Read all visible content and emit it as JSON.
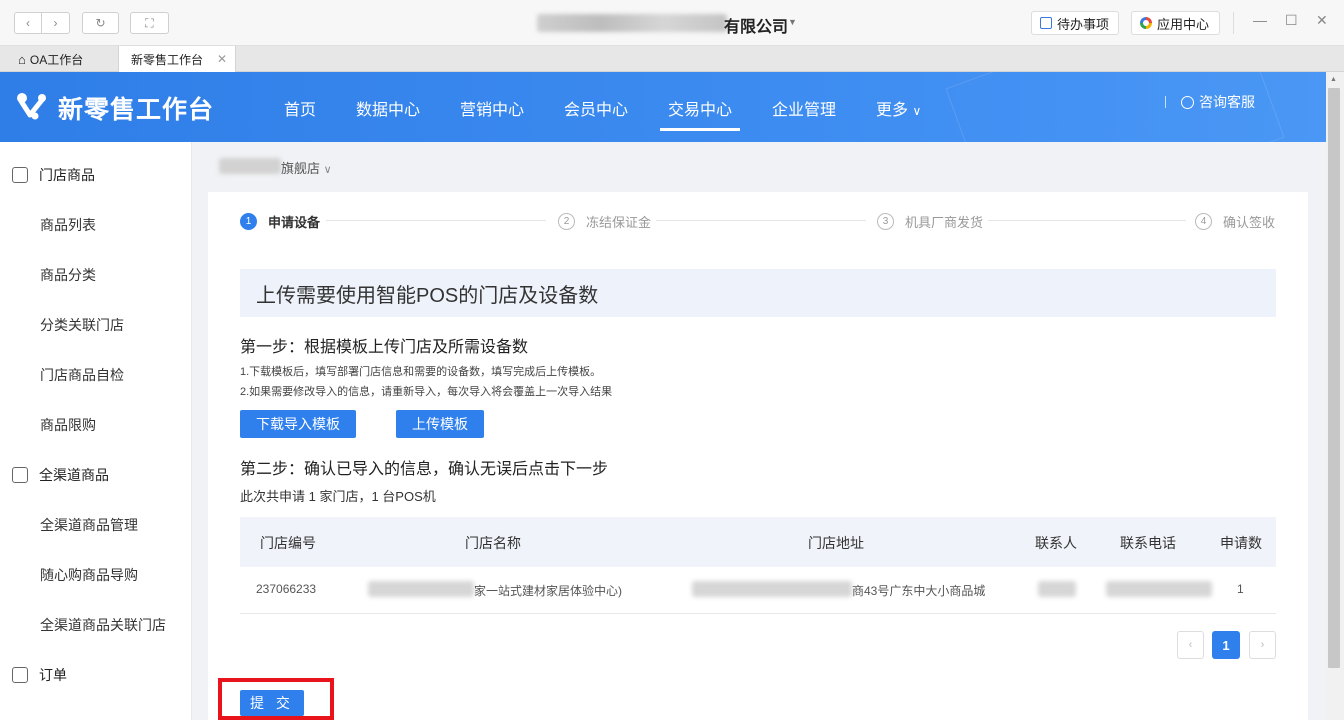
{
  "window": {
    "title": "有限公司",
    "todo_label": "待办事项",
    "apps_label": "应用中心",
    "minimize": "—",
    "maximize": "☐",
    "close": "✕"
  },
  "tabs": [
    {
      "label": "OA工作台"
    },
    {
      "label": "新零售工作台",
      "active": true
    }
  ],
  "header": {
    "brand": "新零售工作台",
    "nav": [
      "首页",
      "数据中心",
      "营销中心",
      "会员中心",
      "交易中心",
      "企业管理",
      "更多"
    ],
    "active_nav": "交易中心",
    "consult": "咨询客服"
  },
  "sidebar": {
    "groups": [
      {
        "label": "门店商品",
        "icon": "store-icon",
        "items": [
          "商品列表",
          "商品分类",
          "分类关联门店",
          "门店商品自检",
          "商品限购"
        ]
      },
      {
        "label": "全渠道商品",
        "icon": "omni-icon",
        "items": [
          "全渠道商品管理",
          "随心购商品导购",
          "全渠道商品关联门店"
        ]
      },
      {
        "label": "订单",
        "icon": "order-icon",
        "items": []
      }
    ]
  },
  "breadcrumb": {
    "store": "旗舰店"
  },
  "steps": [
    {
      "num": "1",
      "label": "申请设备",
      "active": true
    },
    {
      "num": "2",
      "label": "冻结保证金"
    },
    {
      "num": "3",
      "label": "机具厂商发货"
    },
    {
      "num": "4",
      "label": "确认签收"
    }
  ],
  "banner": "上传需要使用智能POS的门店及设备数",
  "step1": {
    "title": "第一步：根据模板上传门店及所需设备数",
    "note1": "1.下载模板后，填写部署门店信息和需要的设备数，填写完成后上传模板。",
    "note2": "2.如果需要修改导入的信息，请重新导入，每次导入将会覆盖上一次导入结果",
    "download_btn": "下载导入模板",
    "upload_btn": "上传模板"
  },
  "step2": {
    "title": "第二步：确认已导入的信息，确认无误后点击下一步",
    "summary": "此次共申请 1 家门店，1 台POS机"
  },
  "table": {
    "columns": [
      "门店编号",
      "门店名称",
      "门店地址",
      "联系人",
      "联系电话",
      "申请数"
    ],
    "rows": [
      {
        "id": "237066233",
        "name": "家一站式建材家居体验中心)",
        "address": "商43号广东中大小商品城",
        "contact": "",
        "phone": "",
        "count": "1"
      }
    ]
  },
  "pager": {
    "current": "1",
    "prev": "‹",
    "next": "›"
  },
  "submit_label": "提 交",
  "colors": {
    "primary": "#2f80ed",
    "header": "#3d8cf1",
    "highlight": "#e8131b"
  }
}
